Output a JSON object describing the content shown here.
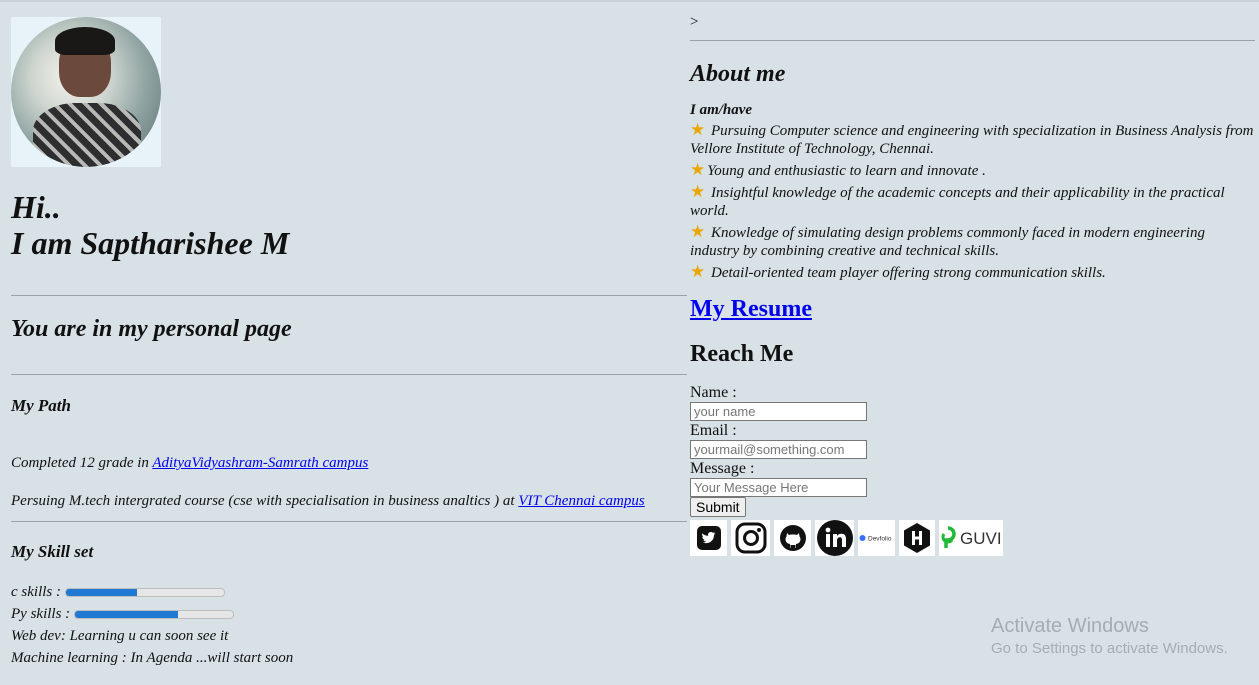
{
  "profile": {
    "greeting": "Hi..",
    "name_line": "I am Saptharishee M",
    "subtitle": "You are in my personal page"
  },
  "path": {
    "title": "My Path",
    "item1_text": "Completed 12 grade in ",
    "item1_link": "AdityaVidyashram-Samrath campus",
    "item2_text": "Persuing M.tech intergrated course (cse with specialisation in business analtics ) at ",
    "item2_link": "VIT Chennai campus"
  },
  "skills": {
    "title": "My Skill set",
    "items": [
      {
        "label": "c skills :",
        "level": 0.45
      },
      {
        "label": "Py skills :",
        "level": 0.65
      }
    ],
    "web_dev": "Web dev: Learning u can soon see it",
    "ml": "Machine learning : In Agenda ...will start soon"
  },
  "about": {
    "arrow": ">",
    "title": "About me",
    "intro": "I am/have",
    "points": [
      "Pursuing Computer science and engineering with specialization in Business Analysis from Vellore Institute of Technology, Chennai.",
      "Young and enthusiastic to learn and innovate .",
      "Insightful knowledge of the academic concepts and their applicability in the practical world.",
      "Knowledge of simulating design problems commonly faced in modern engineering industry by combining creative and technical skills.",
      "Detail-oriented team player offering strong communication skills."
    ],
    "star_icon": "star-icon"
  },
  "resume": {
    "label": "My Resume"
  },
  "reach": {
    "title": "Reach Me",
    "name_label": "Name :",
    "name_placeholder": "your name",
    "email_label": "Email :",
    "email_placeholder": "yourmail@something.com",
    "message_label": "Message :",
    "message_placeholder": "Your Message Here",
    "submit": "Submit"
  },
  "socials": {
    "icons": [
      "twitter-icon",
      "instagram-icon",
      "github-icon",
      "linkedin-icon",
      "devfolio-icon",
      "hashnode-icon",
      "guvi-icon"
    ],
    "devfolio_text": "Devfolio",
    "guvi_text": "GUVI"
  },
  "watermark": {
    "line1": "Activate Windows",
    "line2": "Go to Settings to activate Windows."
  },
  "colors": {
    "background": "#d7e1e6",
    "link": "#0000ee",
    "progress_fill": "#1f78d1"
  }
}
